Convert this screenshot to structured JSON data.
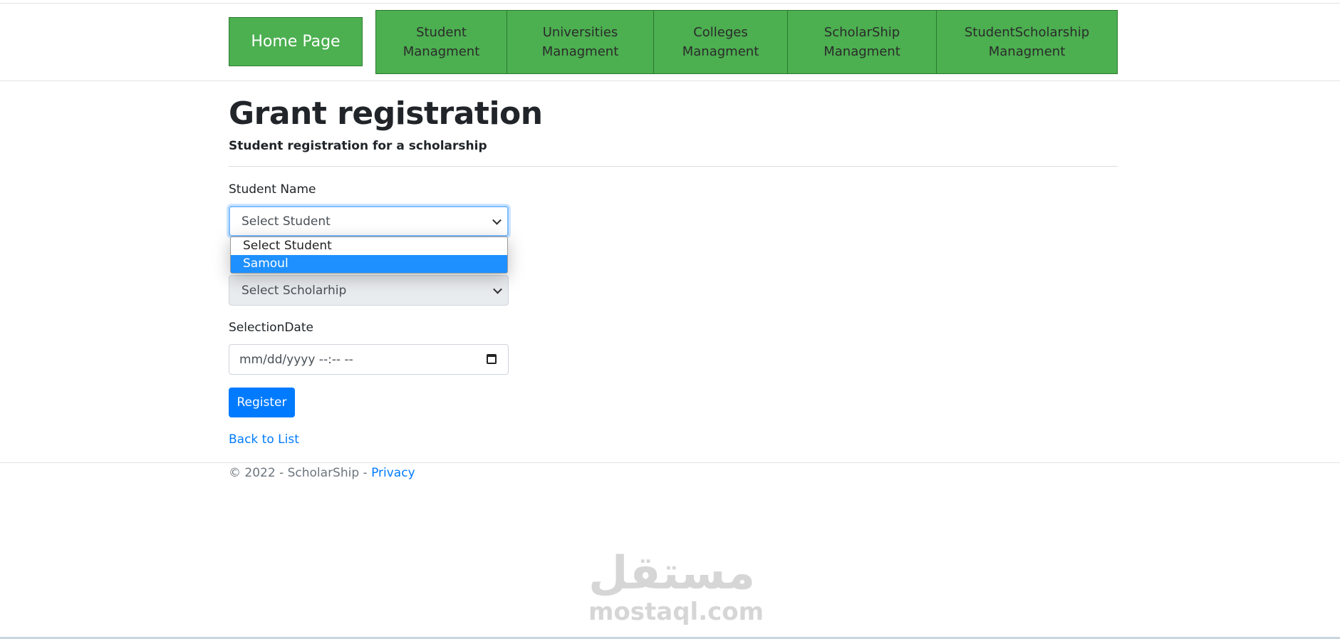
{
  "header": {
    "home_label": "Home Page",
    "nav": [
      {
        "label": "Student\nManagment"
      },
      {
        "label": "Universities\nManagment"
      },
      {
        "label": "Colleges\nManagment"
      },
      {
        "label": "ScholarShip\nManagment"
      },
      {
        "label": "StudentScholarship\nManagment"
      }
    ]
  },
  "main": {
    "title": "Grant registration",
    "subtitle": "Student registration for a scholarship",
    "student_field": {
      "label": "Student Name",
      "value": "Select Student",
      "options": [
        "Select Student",
        "Samoul"
      ],
      "highlighted_option": "Samoul"
    },
    "scholarship_field": {
      "value": "Select Scholarhip"
    },
    "date_field": {
      "label": "SelectionDate",
      "placeholder": "mm/dd/yyyy --:-- --"
    },
    "register_label": "Register",
    "back_link": "Back to List"
  },
  "footer": {
    "copyright": "© 2022 - ScholarShip - ",
    "privacy_link": "Privacy"
  },
  "watermark": {
    "arabic": "مستقل",
    "latin": "mostaql.com"
  },
  "colors": {
    "nav_green": "#4caf50",
    "primary_blue": "#007bff",
    "dropdown_highlight": "#1e90ff"
  }
}
